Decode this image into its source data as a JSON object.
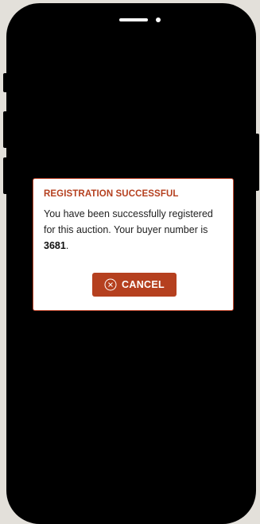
{
  "dialog": {
    "title": "REGISTRATION SUCCESSFUL",
    "message_prefix": "You have been successfully registered for this auction. Your buyer number is ",
    "buyer_number": "3681",
    "message_suffix": ".",
    "cancel_label": "CANCEL",
    "cancel_icon": "close-circle-icon"
  },
  "colors": {
    "accent": "#b5401f",
    "background": "#e3e0da",
    "screen": "#000000"
  }
}
